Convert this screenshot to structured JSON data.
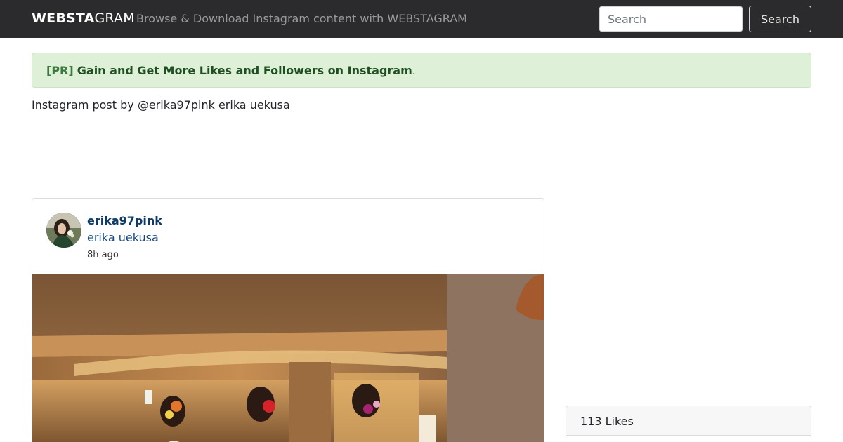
{
  "navbar": {
    "brand_bold": "WEBSTA",
    "brand_rest": "GRAM",
    "tagline": "Browse & Download Instagram content with WEBSTAGRAM",
    "search_placeholder": "Search",
    "search_button": "Search"
  },
  "promo": {
    "tag": "[PR]",
    "link_text": "Gain and Get More Likes and Followers on Instagram",
    "suffix": "."
  },
  "post": {
    "heading": "Instagram post by @erika97pink erika uekusa",
    "username": "erika97pink",
    "full_name": "erika uekusa",
    "time_ago": "8h ago",
    "avatar_icon": "profile-avatar",
    "photo_icon": "post-photo"
  },
  "sidebar": {
    "likes_label": "113 Likes"
  },
  "colors": {
    "navbar_bg": "#2b2b2d",
    "alert_bg": "#dff0d8",
    "alert_text": "#28622a",
    "username": "#0f3a66"
  }
}
